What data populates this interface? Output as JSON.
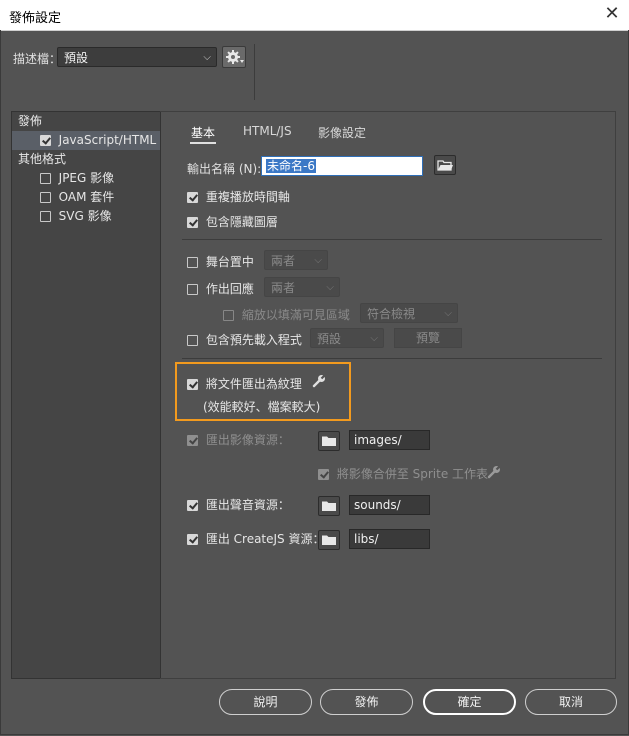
{
  "window": {
    "title": "發佈設定",
    "close_glyph": "✕"
  },
  "profile": {
    "label": "描述檔：",
    "value": "預設"
  },
  "sidebar": {
    "publish_header": "發佈",
    "js_item": "JavaScript/HTML",
    "other_header": "其他格式",
    "jpeg_item": "JPEG 影像",
    "oam_item": "OAM 套件",
    "svg_item": "SVG 影像"
  },
  "tabs": {
    "basic": "基本",
    "html_js": "HTML/JS",
    "image": "影像設定"
  },
  "output": {
    "label": "輸出名稱 (N):",
    "value": "未命名-6"
  },
  "options": {
    "loop": "重複播放時間軸",
    "hidden_layers": "包含隱藏圖層",
    "center_stage": "舞台置中",
    "center_value": "兩者",
    "responsive": "作出回應",
    "responsive_value": "兩者",
    "scale_fill": "縮放以填滿可見區域",
    "scale_value": "符合檢視",
    "preloader": "包含預先載入程式",
    "preloader_value": "預設",
    "preview_label": "預覽",
    "export_texture": "將文件匯出為紋理",
    "export_texture_note": "(效能較好、檔案較大)",
    "export_images": "匯出影像資源：",
    "images_path": "images/",
    "combine_sprite": "將影像合併至 Sprite 工作表",
    "export_sounds": "匯出聲音資源：",
    "sounds_path": "sounds/",
    "export_createjs": "匯出 CreateJS 資源：",
    "libs_path": "libs/"
  },
  "buttons": {
    "help": "說明",
    "publish": "發佈",
    "ok": "確定",
    "cancel": "取消"
  },
  "colors": {
    "highlight": "#f29a1e",
    "background": "#535353",
    "selection": "#3b78c6"
  },
  "icons": {
    "gear": "gear-icon",
    "folder_open": "folder-open-icon",
    "folder": "folder-icon",
    "wrench": "wrench-icon"
  }
}
